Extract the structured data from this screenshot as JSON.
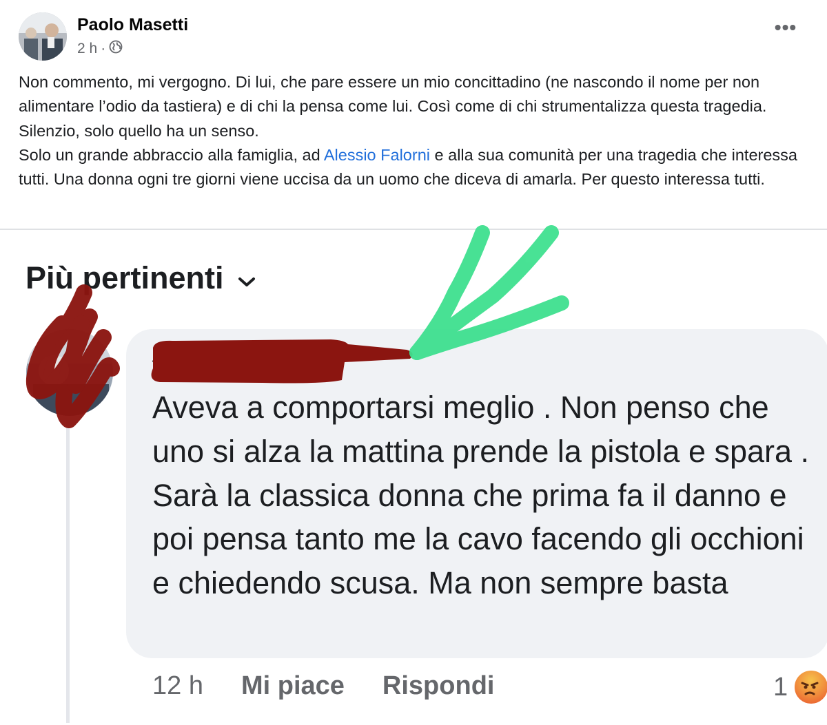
{
  "post": {
    "author": "Paolo Masetti",
    "time": "2 h",
    "separator": "·",
    "paragraph1": "Non commento, mi vergogno. Di lui, che pare essere un mio concittadino (ne nascondo il nome per non alimentare l’odio da tastiera) e di chi la pensa come lui. Così come di chi strumentalizza questa tragedia. Silenzio, solo quello ha un senso.",
    "paragraph2_before": "Solo un grande abbraccio alla famiglia, ad ",
    "mention": "Alessio Falorni",
    "paragraph2_after": " e alla sua comunità per una tragedia che interessa tutti. Una donna ogni tre giorni viene uccisa da un uomo che diceva di amarla. Per questo interessa tutti."
  },
  "comments_section": {
    "sort_label": "Più pertinenti",
    "comment": {
      "author_visible": "S",
      "text": "Aveva a comportarsi meglio . Non penso che uno si alza la mattina prende la pistola e spara . Sarà la classica donna che prima fa il danno e poi pensa tanto me la cavo facendo gli occhioni e chiedendo scusa. Ma non sempre basta",
      "time": "12 h",
      "like_label": "Mi piace",
      "reply_label": "Rispondi",
      "reaction_count": "1"
    }
  },
  "colors": {
    "mention": "#216fdb",
    "redaction": "#8b1510",
    "arrow": "#3fe08f",
    "bubble": "#f0f2f5"
  },
  "icons": [
    "globe-icon",
    "more-options-icon",
    "chevron-down-icon",
    "angry-reaction-icon"
  ]
}
